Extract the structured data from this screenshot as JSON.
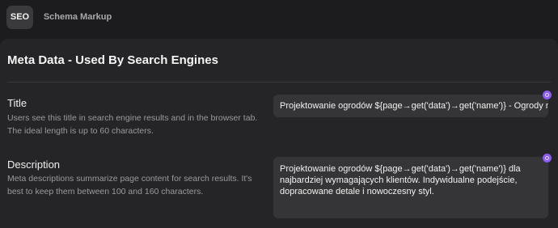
{
  "tabs": {
    "seo": "SEO",
    "schema": "Schema Markup"
  },
  "section": {
    "title": "Meta Data - Used By Search Engines"
  },
  "fields": {
    "title": {
      "label": "Title",
      "help": "Users see this title in search engine results and in the browser tab. The ideal length is up to 60 characters.",
      "value": "Projektowanie ogrodów ${page→get('data')→get('name')} - Ogrody nowoczesne"
    },
    "description": {
      "label": "Description",
      "help": "Meta descriptions summarize page content for search results. It's best to keep them between 100 and 160 characters.",
      "value": "Projektowanie ogrodów ${page→get('data')→get('name')} dla najbardziej wymagających klientów. Indywidualne podejście, dopracowane detale i nowoczesny styl."
    }
  },
  "colors": {
    "accent_badge": "#8b5cf6",
    "background": "#1c1c1e",
    "panel": "#252527",
    "input": "#353537"
  },
  "icons": {
    "field_badge": "ai-badge-icon"
  }
}
